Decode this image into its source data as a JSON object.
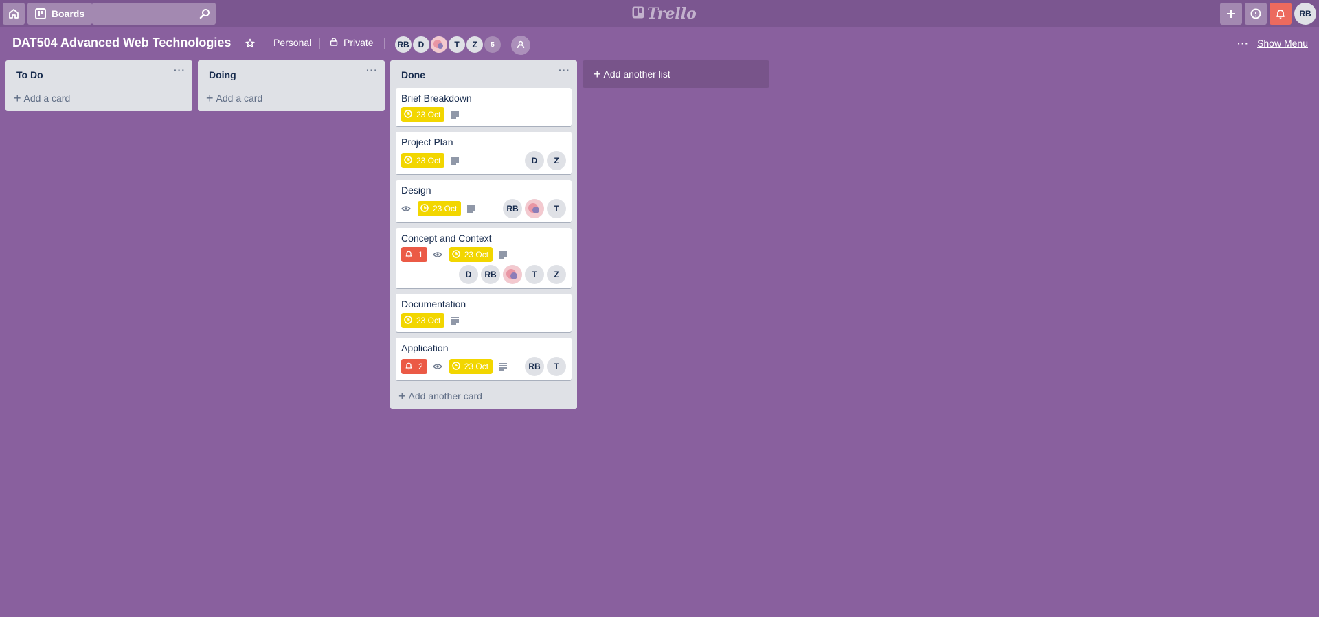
{
  "header": {
    "boards_label": "Boards",
    "search_placeholder": "",
    "logo_text": "Trello",
    "user_initials": "RB"
  },
  "board": {
    "title": "DAT504 Advanced Web Technologies",
    "team": "Personal",
    "visibility": "Private",
    "members": [
      "RB",
      "D",
      "",
      "T",
      "Z"
    ],
    "member_count": "5",
    "show_menu_label": "Show Menu",
    "add_list_label": "Add another list"
  },
  "lists": [
    {
      "title": "To Do",
      "add_card_label": "Add a card"
    },
    {
      "title": "Doing",
      "add_card_label": "Add a card"
    },
    {
      "title": "Done",
      "add_card_label": "Add another card",
      "cards": [
        {
          "title": "Brief Breakdown",
          "due": "23 Oct"
        },
        {
          "title": "Project Plan",
          "due": "23 Oct",
          "members": [
            "D",
            "Z"
          ]
        },
        {
          "title": "Design",
          "due": "23 Oct",
          "members": [
            "RB",
            "",
            "T"
          ]
        },
        {
          "title": "Concept and Context",
          "notifications": "1",
          "due": "23 Oct",
          "members": [
            "D",
            "RB",
            "",
            "T",
            "Z"
          ]
        },
        {
          "title": "Documentation",
          "due": "23 Oct"
        },
        {
          "title": "Application",
          "notifications": "2",
          "due": "23 Oct",
          "members": [
            "RB",
            "T"
          ]
        }
      ]
    }
  ],
  "colors": {
    "background": "#89609e",
    "header": "#7b5690",
    "due_badge": "#f2d600",
    "notification_badge": "#eb5a46",
    "list_bg": "#dfe1e6"
  }
}
